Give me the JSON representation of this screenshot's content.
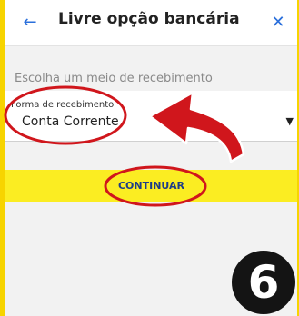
{
  "header": {
    "title": "Livre opção bancária",
    "back_icon": "←",
    "close_icon": "✕"
  },
  "form": {
    "section_label": "Escolha um meio de recebimento",
    "field_label": "Forma de recebimento",
    "field_value": "Conta Corrente",
    "caret": "▼"
  },
  "actions": {
    "continue_label": "CONTINUAR"
  },
  "annotation": {
    "step_number": "6",
    "highlight_color": "#d0161c",
    "frame_color": "#f7d400"
  },
  "colors": {
    "accent_blue": "#2a6fdb",
    "button_yellow": "#fbed22",
    "button_text": "#1d3c88"
  }
}
